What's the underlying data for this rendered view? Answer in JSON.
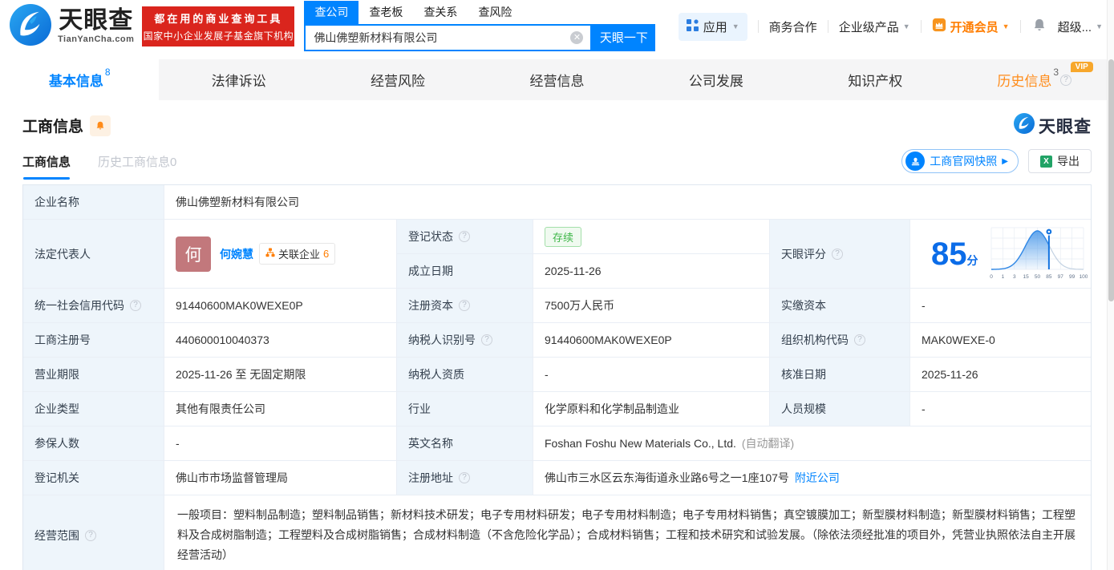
{
  "colors": {
    "brand_blue": "#0084ff",
    "banner_red": "#da251d",
    "member_orange": "#ff7d00",
    "vip_orange": "#f7a72c",
    "status_green": "#3eb648",
    "label_cell_bg": "#eef5fb",
    "score_blue": "#0b6ce8"
  },
  "header": {
    "logo_title": "天眼查",
    "logo_domain": "TianYanCha.com",
    "slogan_line1": "都在用的商业查询工具",
    "slogan_line2": "国家中小企业发展子基金旗下机构",
    "search_tabs": [
      {
        "label": "查公司",
        "active": true
      },
      {
        "label": "查老板",
        "active": false
      },
      {
        "label": "查关系",
        "active": false
      },
      {
        "label": "查风险",
        "active": false
      }
    ],
    "search_value": "佛山佛塑新材料有限公司",
    "search_button": "天眼一下",
    "nav_apps": "应用",
    "nav_cooperation": "商务合作",
    "nav_enterprise": "企业级产品",
    "nav_member": "开通会员",
    "nav_super": "超级..."
  },
  "main_tabs": [
    {
      "label": "基本信息",
      "count": "8",
      "active": true
    },
    {
      "label": "法律诉讼"
    },
    {
      "label": "经营风险"
    },
    {
      "label": "经营信息"
    },
    {
      "label": "公司发展"
    },
    {
      "label": "知识产权"
    },
    {
      "label": "历史信息",
      "count": "3",
      "vip_badge": "VIP"
    }
  ],
  "section": {
    "title": "工商信息",
    "watermark": "天眼查",
    "subtab_current": "工商信息",
    "subtab_history": "历史工商信息0",
    "btn_snapshot": "工商官网快照",
    "btn_export": "导出"
  },
  "fields": {
    "company_name": {
      "label": "企业名称",
      "value": "佛山佛塑新材料有限公司"
    },
    "legal_rep": {
      "label": "法定代表人",
      "avatar": "何",
      "name": "何婉慧",
      "related_label": "关联企业",
      "related_count": "6"
    },
    "reg_status": {
      "label": "登记状态",
      "value": "存续"
    },
    "establish_date": {
      "label": "成立日期",
      "value": "2025-11-26"
    },
    "tyc_score": {
      "label": "天眼评分",
      "value": "85",
      "unit": "分"
    },
    "credit_code": {
      "label": "统一社会信用代码",
      "value": "91440600MAK0WEXE0P"
    },
    "reg_capital": {
      "label": "注册资本",
      "value": "7500万人民币"
    },
    "paid_capital": {
      "label": "实缴资本",
      "value": "-"
    },
    "reg_number": {
      "label": "工商注册号",
      "value": "440600010040373"
    },
    "taxpayer_id": {
      "label": "纳税人识别号",
      "value": "91440600MAK0WEXE0P"
    },
    "org_code": {
      "label": "组织机构代码",
      "value": "MAK0WEXE-0"
    },
    "business_term": {
      "label": "营业期限",
      "value": "2025-11-26 至 无固定期限"
    },
    "taxpayer_quality": {
      "label": "纳税人资质",
      "value": "-"
    },
    "approval_date": {
      "label": "核准日期",
      "value": "2025-11-26"
    },
    "company_type": {
      "label": "企业类型",
      "value": "其他有限责任公司"
    },
    "industry": {
      "label": "行业",
      "value": "化学原料和化学制品制造业"
    },
    "staff_size": {
      "label": "人员规模",
      "value": "-"
    },
    "insured_count": {
      "label": "参保人数",
      "value": "-"
    },
    "english_name": {
      "label": "英文名称",
      "value": "Foshan Foshu New Materials Co., Ltd.",
      "note": "(自动翻译)"
    },
    "reg_authority": {
      "label": "登记机关",
      "value": "佛山市市场监督管理局"
    },
    "reg_address": {
      "label": "注册地址",
      "value": "佛山市三水区云东海街道永业路6号之一1座107号",
      "link": "附近公司"
    },
    "business_scope": {
      "label": "经营范围",
      "value": "一般项目：塑料制品制造；塑料制品销售；新材料技术研发；电子专用材料研发；电子专用材料制造；电子专用材料销售；真空镀膜加工；新型膜材料制造；新型膜材料销售；工程塑料及合成树脂制造；工程塑料及合成树脂销售；合成材料制造（不含危险化学品）；合成材料销售；工程和技术研究和试验发展。（除依法须经批准的项目外，凭营业执照依法自主开展经营活动）"
    }
  },
  "chart_data": {
    "type": "area",
    "title": "天眼评分分布曲线",
    "score": 85,
    "score_unit": "分",
    "x_ticks": [
      "0",
      "1",
      "3",
      "15",
      "50",
      "85",
      "97",
      "99",
      "100"
    ],
    "peak_tick_index": 4,
    "marker_tick_index": 5,
    "grid": true
  }
}
